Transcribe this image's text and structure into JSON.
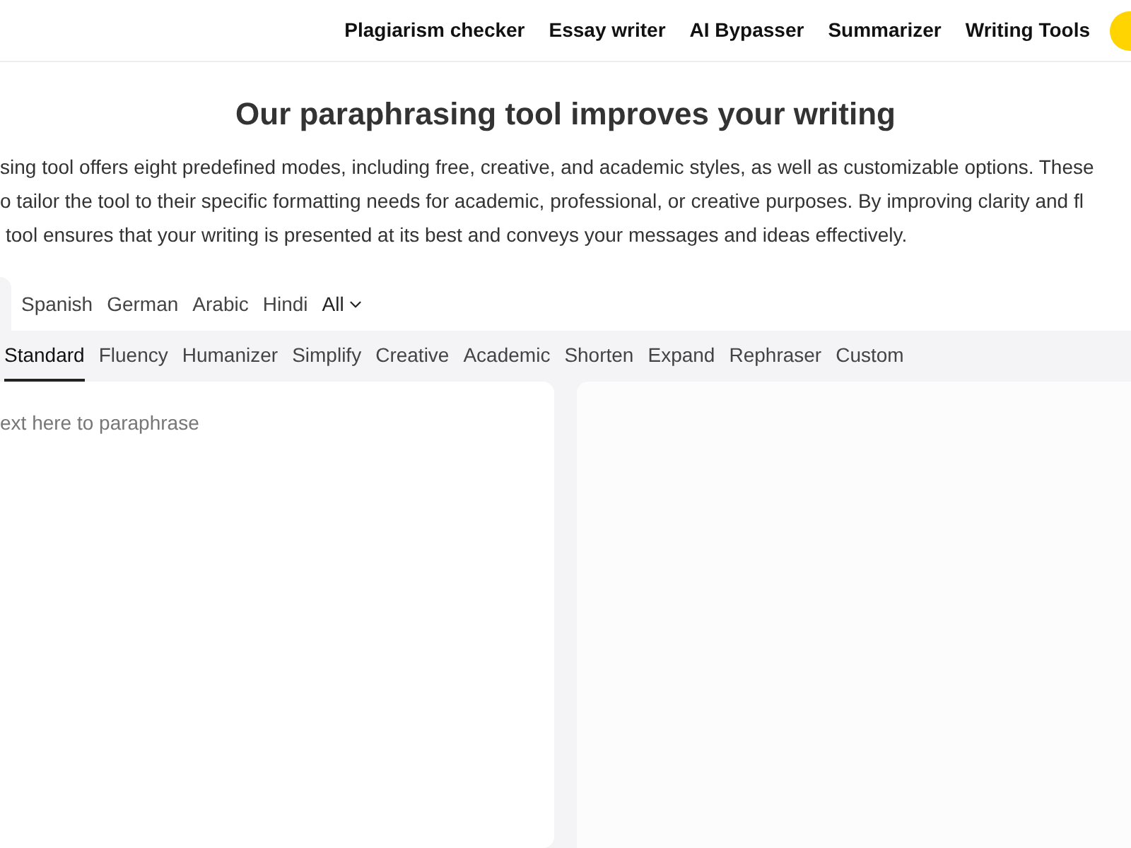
{
  "nav": {
    "links": [
      "Plagiarism checker",
      "Essay writer",
      "AI Bypasser",
      "Summarizer",
      "Writing Tools"
    ]
  },
  "heading": "Our paraphrasing tool improves your writing",
  "intro_lines": [
    "sing tool offers eight predefined modes, including free, creative, and academic styles, as well as customizable options. These",
    "o tailor the tool to their specific formatting needs for academic, professional, or creative purposes. By improving clarity and fl",
    "tool ensures that your writing is presented at its best and conveys your messages and ideas effectively."
  ],
  "languages": [
    {
      "label": "Spanish",
      "selected": false
    },
    {
      "label": "German",
      "selected": false
    },
    {
      "label": "Arabic",
      "selected": false
    },
    {
      "label": "Hindi",
      "selected": false
    }
  ],
  "all_languages": "All",
  "modes": [
    {
      "label": "Standard",
      "selected": true
    },
    {
      "label": "Fluency",
      "selected": false
    },
    {
      "label": "Humanizer",
      "selected": false
    },
    {
      "label": "Simplify",
      "selected": false
    },
    {
      "label": "Creative",
      "selected": false
    },
    {
      "label": "Academic",
      "selected": false
    },
    {
      "label": "Shorten",
      "selected": false
    },
    {
      "label": "Expand",
      "selected": false
    },
    {
      "label": "Rephraser",
      "selected": false
    },
    {
      "label": "Custom",
      "selected": false
    }
  ],
  "input": {
    "placeholder": "ext here to paraphrase"
  }
}
